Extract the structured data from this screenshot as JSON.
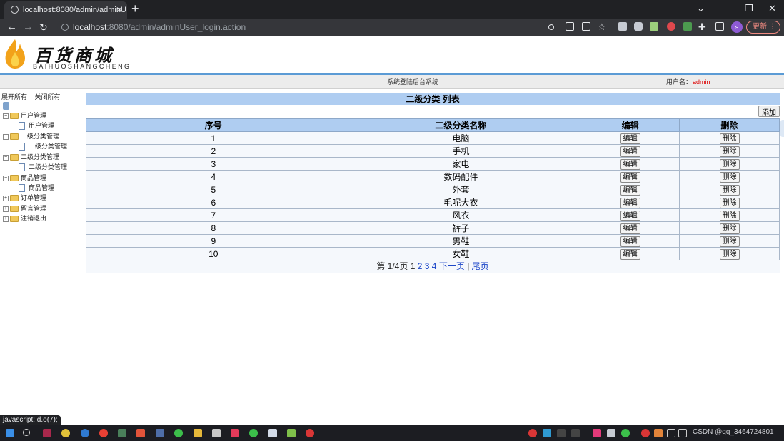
{
  "browser": {
    "tab_title": "localhost:8080/admin/adminU",
    "url_host": "localhost",
    "url_rest": ":8080/admin/adminUser_login.action",
    "profile_initial": "s",
    "update_label": "更新"
  },
  "header": {
    "logo_cn": "百货商城",
    "logo_en": "BAIHUOSHANGCHENG",
    "system_title": "系统登陆后台系统",
    "user_label": "用户名：",
    "user_name": "admin"
  },
  "sidebar": {
    "expand_all": "展开所有",
    "collapse_all": "关闭所有",
    "groups": [
      {
        "label": "用户管理",
        "child": "用户管理"
      },
      {
        "label": "一级分类管理",
        "child": "一级分类管理"
      },
      {
        "label": "二级分类管理",
        "child": "二级分类管理"
      },
      {
        "label": "商品管理",
        "child": "商品管理"
      },
      {
        "label": "订单管理"
      },
      {
        "label": "留言管理"
      },
      {
        "label": "注销退出"
      }
    ]
  },
  "main": {
    "title": "二级分类 列表",
    "add_label": "添加",
    "columns": [
      "序号",
      "二级分类名称",
      "编辑",
      "删除"
    ],
    "edit_label": "编辑",
    "delete_label": "删除",
    "rows": [
      {
        "no": "1",
        "name": "电脑"
      },
      {
        "no": "2",
        "name": "手机"
      },
      {
        "no": "3",
        "name": "家电"
      },
      {
        "no": "4",
        "name": "数码配件"
      },
      {
        "no": "5",
        "name": "外套"
      },
      {
        "no": "6",
        "name": "毛呢大衣"
      },
      {
        "no": "7",
        "name": "风衣"
      },
      {
        "no": "8",
        "name": "裤子"
      },
      {
        "no": "9",
        "name": "男鞋"
      },
      {
        "no": "10",
        "name": "女鞋"
      }
    ],
    "pager": {
      "prefix": "第 1/4页",
      "current": "1",
      "pages": [
        "2",
        "3",
        "4"
      ],
      "next": "下一页",
      "sep": "|",
      "last": "尾页"
    }
  },
  "status_text": "javascript: d.o(7);",
  "tray": {
    "text": "CSDN @qq_3464724801"
  },
  "colors": {
    "header_blue": "#afcdf1",
    "accent_line": "#5b9bd5",
    "link": "#1a45c8",
    "user_red": "#dd0000"
  }
}
